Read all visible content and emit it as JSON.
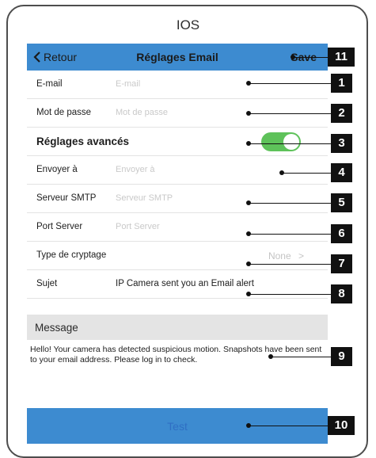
{
  "os_label": "IOS",
  "navbar": {
    "back_label": "Retour",
    "title": "Réglages Email",
    "save_label": "Save"
  },
  "fields": {
    "email": {
      "label": "E-mail",
      "placeholder": "E-mail"
    },
    "password": {
      "label": "Mot de passe",
      "placeholder": "Mot de passe"
    },
    "advanced": {
      "label": "Réglages avancés",
      "toggle_on": true
    },
    "send_to": {
      "label": "Envoyer à",
      "placeholder": "Envoyer à"
    },
    "smtp_server": {
      "label": "Serveur SMTP",
      "placeholder": "Serveur SMTP"
    },
    "port_server": {
      "label": "Port Server",
      "placeholder": "Port Server"
    },
    "encryption": {
      "label": "Type de cryptage",
      "value": "None",
      "chevron": ">"
    },
    "subject": {
      "label": "Sujet",
      "value": "IP Camera sent you an Email alert"
    }
  },
  "message": {
    "header": "Message",
    "body": "Hello! Your camera has detected suspicious motion. Snapshots have been sent to your email address. Please log in to check."
  },
  "test_button": {
    "label": "Test"
  },
  "callouts": [
    "1",
    "2",
    "3",
    "4",
    "5",
    "6",
    "7",
    "8",
    "9",
    "10",
    "11"
  ],
  "colors": {
    "accent": "#3d8bd0",
    "toggle": "#5ec25a",
    "badge": "#111111"
  }
}
